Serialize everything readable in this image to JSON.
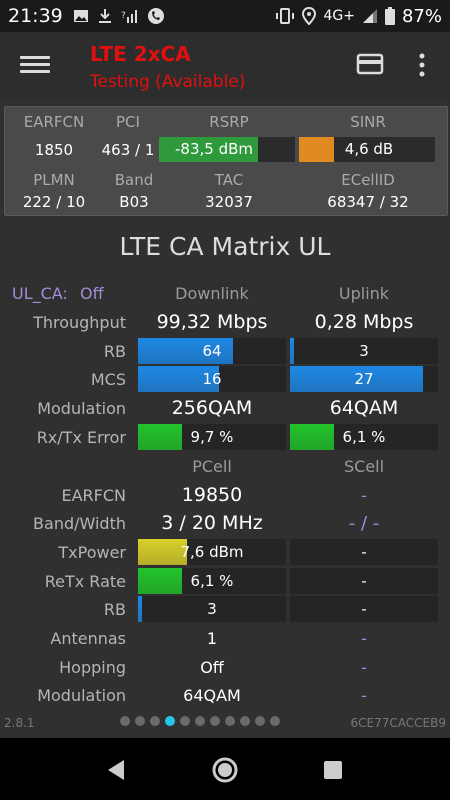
{
  "status": {
    "time": "21:39",
    "network": "4G+",
    "battery": "87%"
  },
  "app": {
    "title": "LTE 2xCA",
    "subtitle": "Testing (Available)"
  },
  "info": {
    "headers": [
      "EARFCN",
      "PCI",
      "RSRP",
      "SINR"
    ],
    "earfcn": "1850",
    "pci": "463 / 1",
    "rsrp": "-83,5 dBm",
    "sinr": "4,6 dB",
    "headers2": [
      "PLMN",
      "Band",
      "TAC",
      "ECellID"
    ],
    "plmn": "222 / 10",
    "band": "B03",
    "tac": "32037",
    "ecellid": "68347 / 32",
    "rsrp_level": 0.73,
    "sinr_level": 0.26,
    "colors": {
      "rsrp": "#2e9a3c",
      "sinr": "#e08a20"
    }
  },
  "matrix": {
    "title": "LTE CA Matrix UL",
    "ul_ca_label": "UL_CA:",
    "ul_ca_value": "Off",
    "col_downlink": "Downlink",
    "col_uplink": "Uplink",
    "rows1": {
      "throughput": {
        "label": "Throughput",
        "dl": "99,32 Mbps",
        "ul": "0,28 Mbps"
      },
      "rb": {
        "label": "RB",
        "dl": "64",
        "ul": "3",
        "dl_level": 0.64,
        "ul_level": 0.03
      },
      "mcs": {
        "label": "MCS",
        "dl": "16",
        "ul": "27",
        "dl_level": 0.55,
        "ul_level": 0.9
      },
      "modulation": {
        "label": "Modulation",
        "dl": "256QAM",
        "ul": "64QAM"
      },
      "error": {
        "label": "Rx/Tx Error",
        "dl": "9,7 %",
        "ul": "6,1 %",
        "dl_level": 0.3,
        "ul_level": 0.3
      }
    },
    "col_pcell": "PCell",
    "col_scell": "SCell",
    "rows2": {
      "earfcn": {
        "label": "EARFCN",
        "p": "19850",
        "s": "-"
      },
      "bandwidth": {
        "label": "Band/Width",
        "p": "3 / 20 MHz",
        "s": "- / -"
      },
      "txpower": {
        "label": "TxPower",
        "p": "7,6 dBm",
        "s": "-",
        "p_level": 0.33
      },
      "retx": {
        "label": "ReTx Rate",
        "p": "6,1 %",
        "s": "-",
        "p_level": 0.3
      },
      "rb": {
        "label": "RB",
        "p": "3",
        "s": "-",
        "p_level": 0.03
      },
      "antennas": {
        "label": "Antennas",
        "p": "1",
        "s": "-"
      },
      "hopping": {
        "label": "Hopping",
        "p": "Off",
        "s": "-"
      },
      "modulation": {
        "label": "Modulation",
        "p": "64QAM",
        "s": "-"
      }
    }
  },
  "footer": {
    "version": "2.8.1",
    "code": "6CE77CACCEB9",
    "page_index": 3,
    "page_count": 11
  },
  "colors": {
    "title_red": "#e01010",
    "blue": "#1e88e5",
    "green": "#22c42a",
    "yellow": "#d8d02a",
    "purple": "#a48bd8",
    "dot_active": "#26c6ea"
  }
}
